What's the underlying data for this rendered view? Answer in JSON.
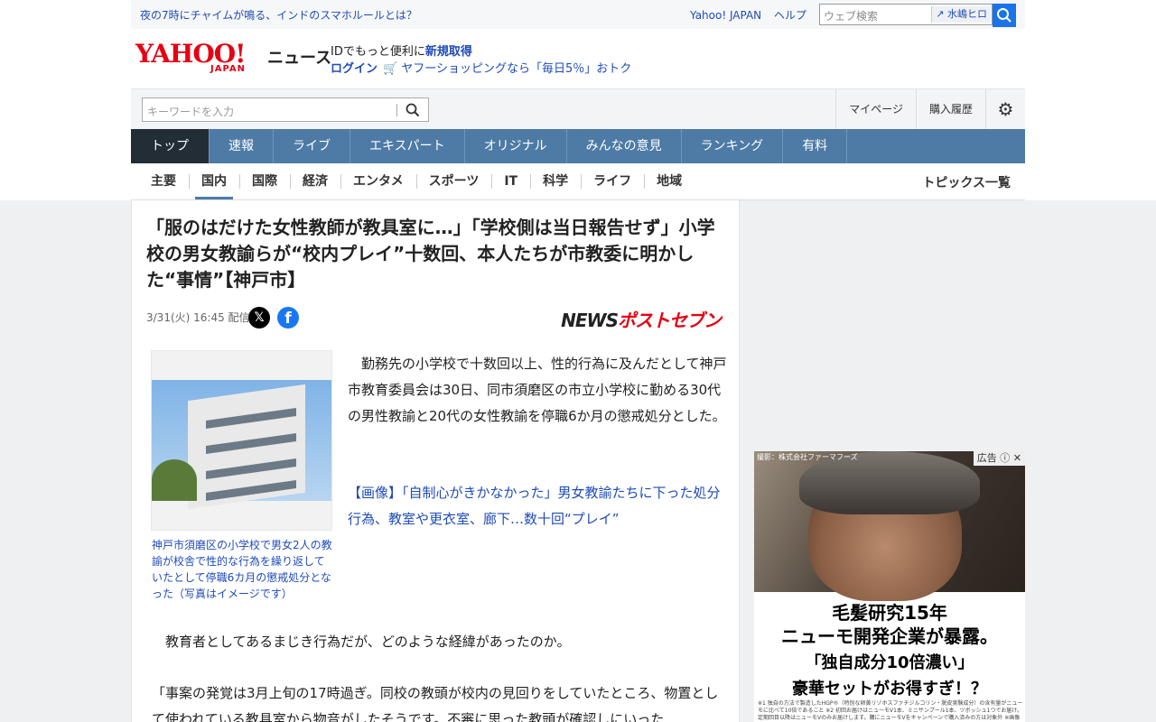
{
  "topbar": {
    "trending": "夜の7時にチャイムが鳴る、インドのスマホルールとは？",
    "links": [
      "Yahoo! JAPAN",
      "ヘルプ"
    ],
    "web_search_placeholder": "ウェブ検索",
    "web_search_chip": "水嶋ヒロ"
  },
  "header": {
    "logo_text": "YAHOO!",
    "logo_sub": "JAPAN",
    "service": "ニュース",
    "id_line_prefix": "IDでもっと便利に",
    "id_line_link": "新規取得",
    "login": "ログイン",
    "shopping": "ヤフーショッピングなら「毎日5％」おトク"
  },
  "search": {
    "placeholder": "キーワードを入力",
    "menu": [
      "マイページ",
      "購入履歴"
    ]
  },
  "main_nav": [
    "トップ",
    "速報",
    "ライブ",
    "エキスパート",
    "オリジナル",
    "みんなの意見",
    "ランキング",
    "有料"
  ],
  "sub_nav": [
    "主要",
    "国内",
    "国際",
    "経済",
    "エンタメ",
    "スポーツ",
    "IT",
    "科学",
    "ライフ",
    "地域"
  ],
  "topics_link": "トピックス一覧",
  "article": {
    "title": "「服のはだけた女性教師が教具室に…」「学校側は当日報告せず」小学校の男女教諭らが“校内プレイ”十数回、本人たちが市教委に明かした“事情”【神戸市】",
    "date": "3/31(火) 16:45 配信",
    "publisher_a": "NEWS",
    "publisher_b": "ポストセブン",
    "caption": "神戸市須磨区の小学校で男女2人の教諭が校舎で性的な行為を繰り返していたとして停職6カ月の懲戒処分となった（写真はイメージです）",
    "para1": "　勤務先の小学校で十数回以上、性的行為に及んだとして神戸市教育委員会は30日、同市須磨区の市立小学校に勤める30代の男性教諭と20代の女性教諭を停職6か月の懲戒処分とした。",
    "image_link": "【画像】「自制心がきかなかった」男女教諭たちに下った処分行為、教室や更衣室、廊下…数十回“プレイ”",
    "para2": "　教育者としてあるまじき行為だが、どのような経緯があったのか。",
    "para3": "「事案の発覚は3月上旬の17時過ぎ。同校の教頭が校内の見回りをしていたところ、物置として使われている教具室から物音がしたそうです。不審に思った教頭が確認しにいった"
  },
  "ad": {
    "badge": "広告",
    "credit": "撮影：株式会社ファーマフーズ",
    "line1": "毛髪研究15年",
    "line2": "ニューモ開発企業が暴露。",
    "line3": "「独自成分10倍濃い」",
    "line4": "豪華セットがお得すぎ！？",
    "fine_print": "※1 独自の方法で製造したHGP®（特別な卵黄リゾホスファチジルコリン・脱皮実験成分）の含有量がニューモに比べて10倍であること ※2 初回お届けはニューモV1本、ミニサンプール1本、ツボッシュ1つでお届け。定期回目以降はニューモVのみお届けします。購にニューモVをキャンペーンで購入済みの方は対象外 ※画像はイメージです。"
  },
  "colors": {
    "brand_red": "#e60012",
    "link_blue": "#1f4bb7",
    "nav_blue": "#4d7ba5",
    "nav_active": "#222d36"
  }
}
